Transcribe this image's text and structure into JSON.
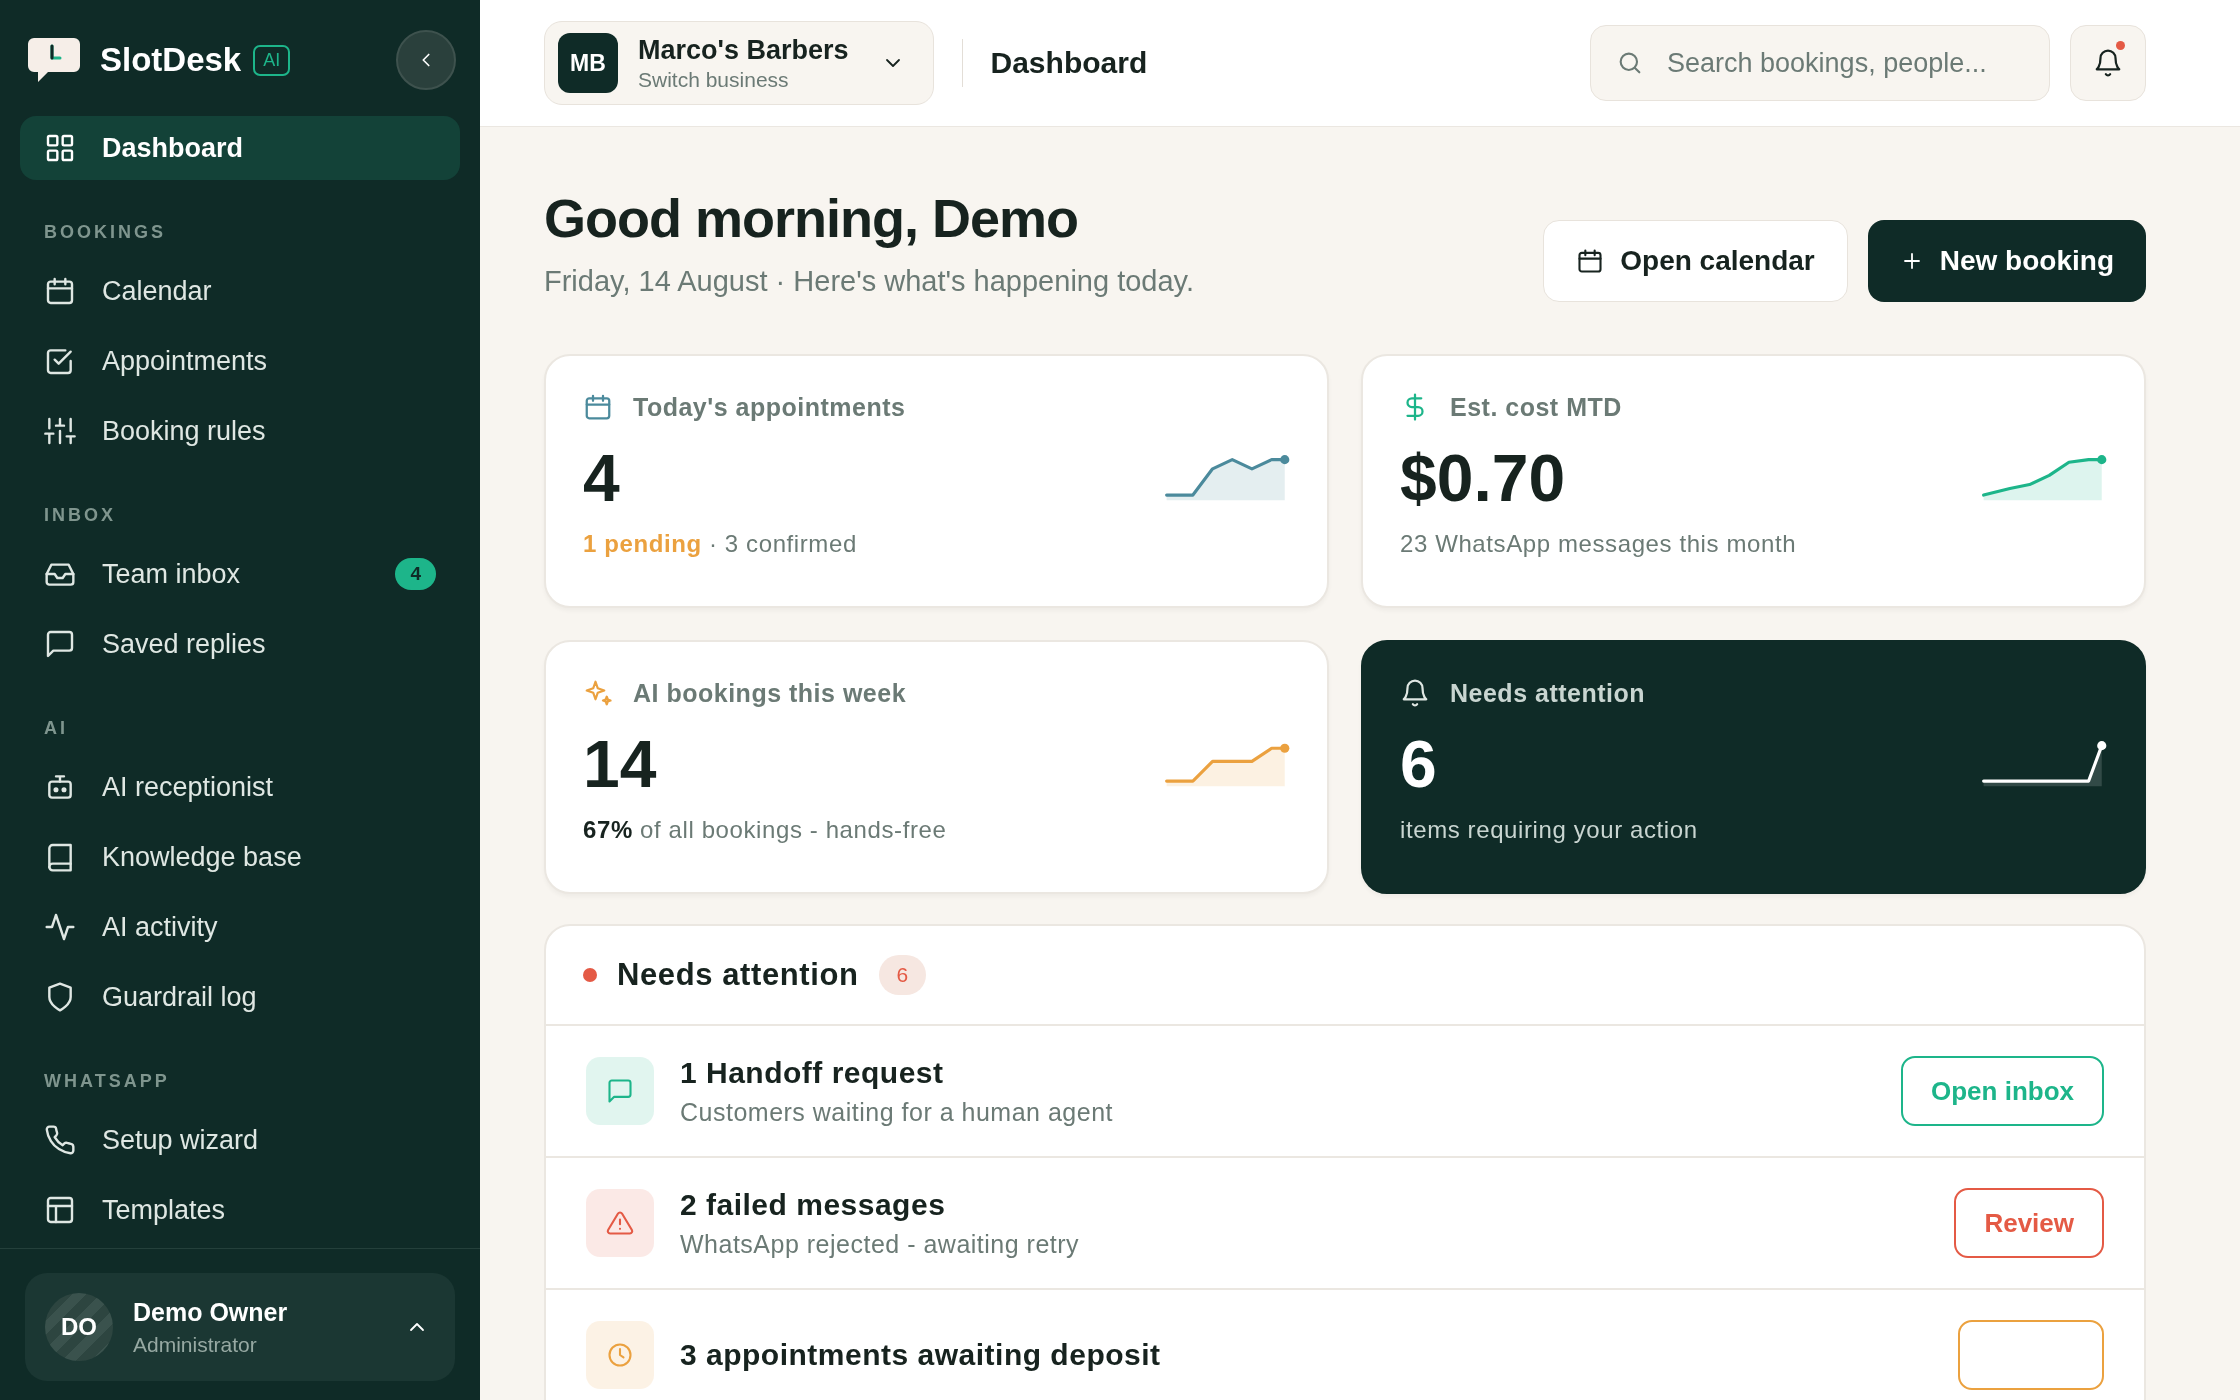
{
  "brand": {
    "name": "SlotDesk",
    "badge": "AI"
  },
  "sidebar": {
    "items": [
      {
        "kind": "link",
        "label": "Dashboard",
        "selected": true
      },
      {
        "kind": "heading",
        "label": "BOOKINGS"
      },
      {
        "kind": "link",
        "label": "Calendar",
        "selected": false
      },
      {
        "kind": "link",
        "label": "Appointments",
        "selected": false
      },
      {
        "kind": "link",
        "label": "Booking rules",
        "selected": false
      },
      {
        "kind": "heading",
        "label": "INBOX"
      },
      {
        "kind": "link",
        "label": "Team inbox",
        "selected": false,
        "badge": "4"
      },
      {
        "kind": "link",
        "label": "Saved replies",
        "selected": false
      },
      {
        "kind": "heading",
        "label": "AI"
      },
      {
        "kind": "link",
        "label": "AI receptionist",
        "selected": false
      },
      {
        "kind": "link",
        "label": "Knowledge base",
        "selected": false
      },
      {
        "kind": "link",
        "label": "AI activity",
        "selected": false
      },
      {
        "kind": "link",
        "label": "Guardrail log",
        "selected": false
      },
      {
        "kind": "heading",
        "label": "WHATSAPP"
      },
      {
        "kind": "link",
        "label": "Setup wizard",
        "selected": false
      },
      {
        "kind": "link",
        "label": "Templates",
        "selected": false
      }
    ],
    "user": {
      "initials": "DO",
      "name": "Demo Owner",
      "role": "Administrator"
    }
  },
  "header": {
    "business": {
      "initials": "MB",
      "name": "Marco's Barbers",
      "subtitle": "Switch business"
    },
    "page_title": "Dashboard",
    "search": {
      "placeholder": "Search bookings, people..."
    },
    "notifications": {
      "unread": true
    }
  },
  "greeting": {
    "title": "Good morning, Demo",
    "subtitle": "Friday, 14 August · Here's what's happening today.",
    "actions": [
      {
        "kind": "secondary",
        "label": "Open calendar"
      },
      {
        "kind": "primary",
        "label": "New booking"
      }
    ]
  },
  "stats": [
    {
      "title": "Today's appointments",
      "value": "4",
      "dark": false,
      "color": "#4b8a9c",
      "note": [
        {
          "text": "1 pending",
          "color": "#eba13f"
        },
        {
          "text": "· 3 confirmed"
        }
      ]
    },
    {
      "title": "Est. cost MTD",
      "value": "$0.70",
      "dark": false,
      "color": "#1db58a",
      "note": [
        {
          "text": "23 WhatsApp messages this month"
        }
      ]
    },
    {
      "title": "AI bookings this week",
      "value": "14",
      "dark": false,
      "color": "#eba13f",
      "note": [
        {
          "text": "67%",
          "color": "#17231f"
        },
        {
          "text": "of all bookings - hands-free"
        }
      ]
    },
    {
      "title": "Needs attention",
      "value": "6",
      "dark": true,
      "color": "#ffffff",
      "note": [
        {
          "text": "items requiring your action"
        }
      ]
    }
  ],
  "attention": {
    "title": "Needs attention",
    "count": "6",
    "items": [
      {
        "color": "#1db58a",
        "title": "1 Handoff request",
        "detail": "Customers waiting for a human agent",
        "action": "Open inbox"
      },
      {
        "color": "#e45a45",
        "title": "2 failed messages",
        "detail": "WhatsApp rejected - awaiting retry",
        "action": "Review"
      },
      {
        "color": "#eba13f",
        "title": "3 appointments awaiting deposit"
      }
    ]
  }
}
